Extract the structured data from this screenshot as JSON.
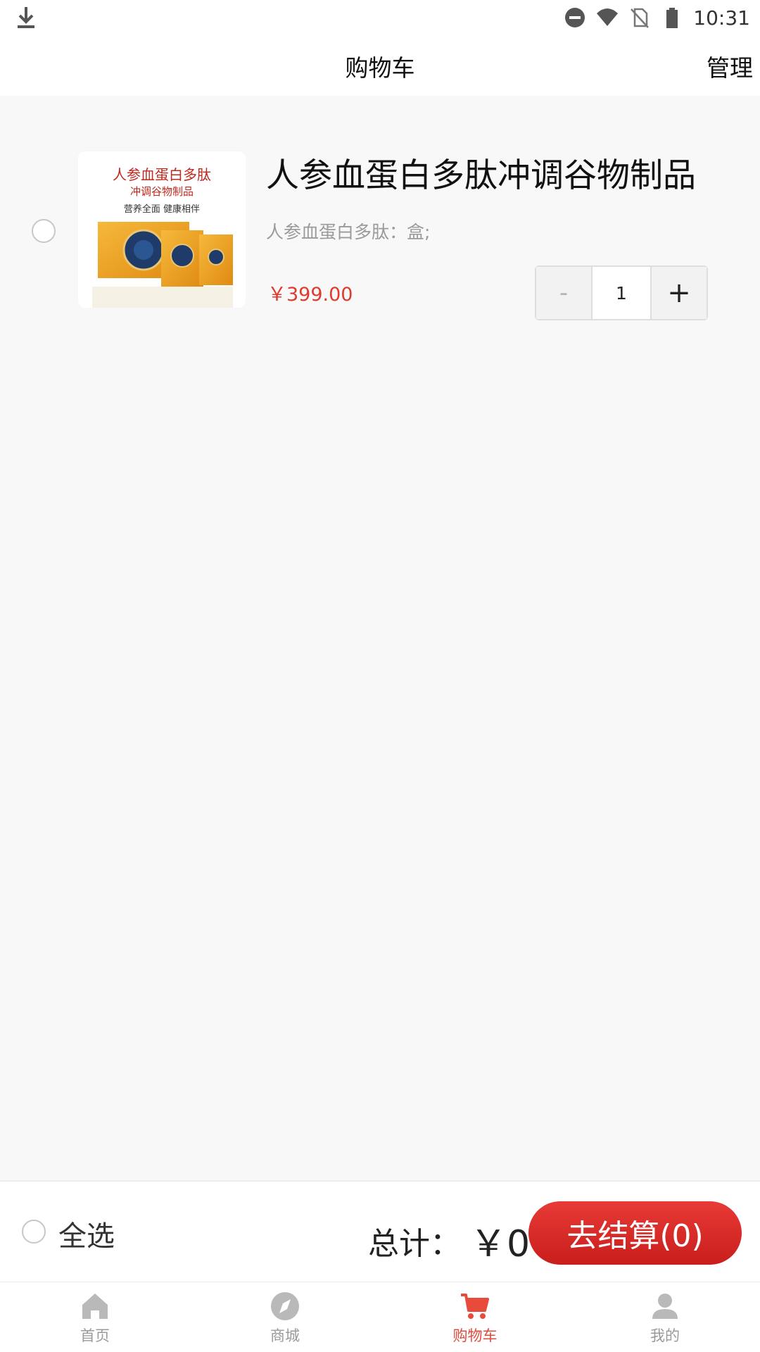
{
  "status_bar": {
    "time": "10:31"
  },
  "header": {
    "title": "购物车",
    "manage": "管理"
  },
  "cart": {
    "items": [
      {
        "title": "人参血蛋白多肽冲调谷物制品",
        "spec": "人参血蛋白多肽：盒;",
        "price": "￥399.00",
        "quantity": "1",
        "minus_label": "-",
        "plus_label": "+",
        "image": {
          "line1": "人参血蛋白多肽",
          "line2": "冲调谷物制品",
          "line3": "营养全面  健康相伴"
        }
      }
    ]
  },
  "checkout": {
    "select_all": "全选",
    "total_label": "总计：",
    "total_value": "￥0",
    "button": "去结算(0)"
  },
  "tabs": [
    {
      "label": "首页",
      "icon": "home-icon"
    },
    {
      "label": "商城",
      "icon": "compass-icon"
    },
    {
      "label": "购物车",
      "icon": "cart-icon"
    },
    {
      "label": "我的",
      "icon": "user-icon"
    }
  ],
  "colors": {
    "accent": "#e03a2e",
    "active_tab": "#e04b3c",
    "inactive": "#9a9a9a",
    "background": "#f8f8f8"
  }
}
